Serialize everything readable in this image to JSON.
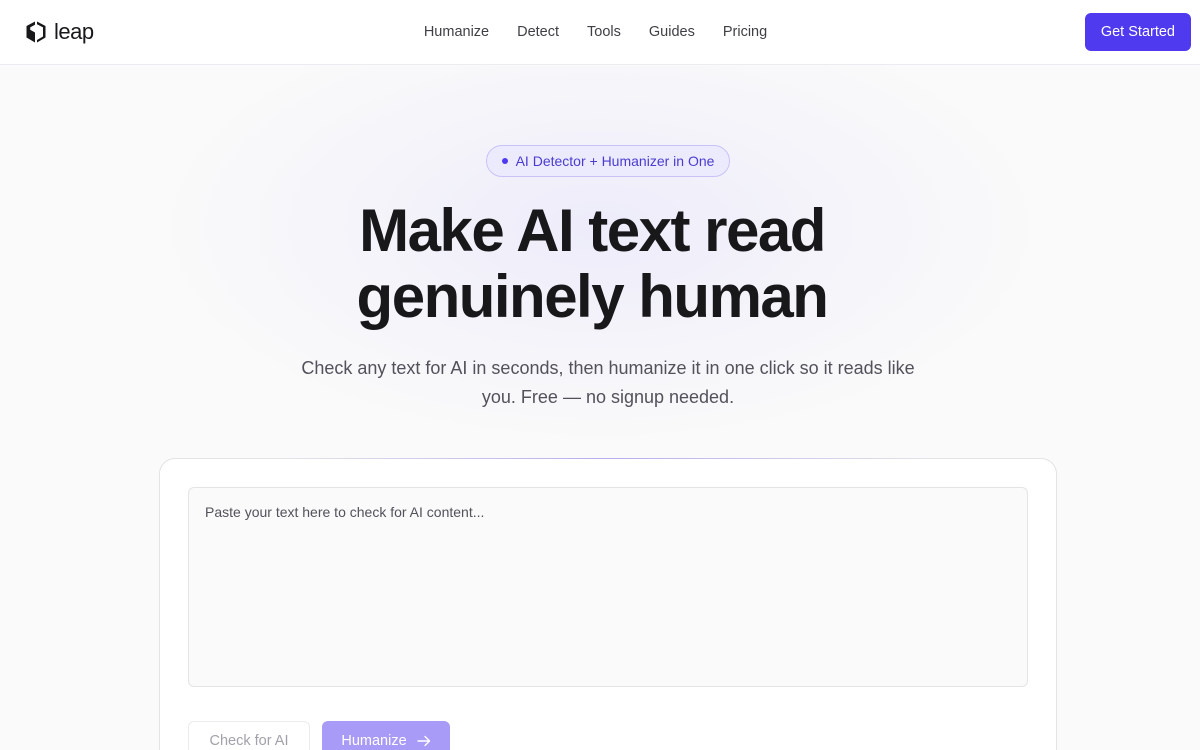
{
  "header": {
    "logo_text": "leap",
    "nav": [
      {
        "label": "Humanize"
      },
      {
        "label": "Detect"
      },
      {
        "label": "Tools"
      },
      {
        "label": "Guides"
      },
      {
        "label": "Pricing"
      }
    ],
    "cta_label": "Get Started"
  },
  "hero": {
    "badge": "AI Detector + Humanizer in One",
    "headline_line1": "Make AI text read",
    "headline_line2": "genuinely human",
    "subtitle_line1": "Check any text for AI in seconds, then humanize it in one click so it reads like",
    "subtitle_line2": "you. Free — no signup needed."
  },
  "editor": {
    "value": "",
    "placeholder": "Paste your text here to check for AI content...",
    "check_label": "Check for AI",
    "humanize_label": "Humanize"
  },
  "icons": {
    "logo": "leap-logo-icon",
    "badge_dot": "dot-icon",
    "humanize_arrow": "arrow-right-icon"
  },
  "colors": {
    "accent": "#4f3af0",
    "accent_disabled": "#a89af7",
    "badge_bg": "#ecebfd",
    "badge_text": "#4b3bd0",
    "text_primary": "#18181b",
    "text_secondary": "#52525b",
    "page_bg": "#fafafa"
  }
}
